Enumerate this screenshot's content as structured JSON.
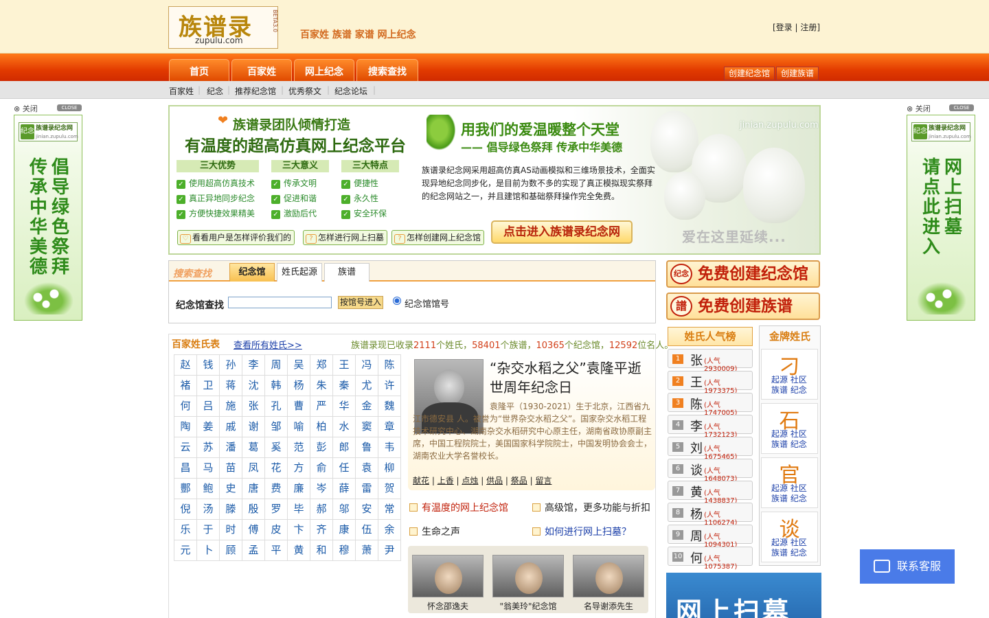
{
  "header": {
    "logo_cn": "族谱录",
    "logo_en": "zupulu.com",
    "logo_beta": "BETA3.0",
    "slogan": "百家姓 族谱 家谱 网上纪念",
    "login": "[登录",
    "auth_sep": "|",
    "register": "注册]"
  },
  "nav": {
    "items": [
      "首页",
      "百家姓",
      "网上纪念",
      "搜索查找"
    ],
    "create_memorial": "创建纪念馆",
    "create_genealogy": "创建族谱"
  },
  "subnav": {
    "items": [
      "百家姓",
      "纪念",
      "推荐纪念馆",
      "优秀祭文",
      "纪念论坛"
    ]
  },
  "side_left": {
    "close": "关闭",
    "badge": "CLOSE",
    "logo_line1": "族谱录纪念网",
    "logo_line2": "jinian.zupulu.com",
    "seal": "纪念",
    "col_right": "倡导绿色祭拜",
    "col_left": "传承中华美德"
  },
  "side_right": {
    "close": "关闭",
    "badge": "CLOSE",
    "logo_line1": "族谱录纪念网",
    "logo_line2": "jinian.zupulu.com",
    "seal": "纪念",
    "col_right": "网上扫墓",
    "col_left": "请点此进入"
  },
  "banner": {
    "heart": "❤",
    "title1": "族谱录团队倾情打造",
    "title2": "有温度的超高仿真网上纪念平台",
    "col1_head": "三大优势",
    "col1": [
      "使用超高仿真技术",
      "真正异地同步纪念",
      "方便快捷效果精美"
    ],
    "col2_head": "三大意义",
    "col2": [
      "传承文明",
      "促进和谐",
      "激励后代"
    ],
    "col3_head": "三大特点",
    "col3": [
      "便捷性",
      "永久性",
      "安全环保"
    ],
    "btn_reviews": "看看用户是怎样评价我们的",
    "btn_how_scan": "怎样进行网上扫墓",
    "btn_how_create": "怎样创建网上纪念馆",
    "enter": "点击进入族谱录纪念网",
    "right_title": "用我们的爱温暖整个天堂",
    "right_sub": "—— 倡导绿色祭拜 传承中华美德",
    "url": "jinian.zupulu.com",
    "desc": "族谱录纪念网采用超高仿真AS动画模拟和三维场景技术，全面实现异地纪念同步化，是目前为数不多的实现了真正模拟现实祭拜的纪念网站之一，并且建馆和基础祭拜操作完全免费。",
    "bottom": "爱在这里延续..."
  },
  "search": {
    "title": "搜索查找",
    "tabs": [
      "纪念馆",
      "姓氏起源",
      "族谱"
    ],
    "label": "纪念馆查找",
    "input_value": "",
    "button": "按馆号进入",
    "radio_label": "纪念馆馆号"
  },
  "create_buttons": {
    "memorial": "免费创建纪念馆",
    "memorial_seal": "纪念",
    "genealogy": "免费创建族谱",
    "genealogy_seal": "譜"
  },
  "surnames": {
    "title": "百家姓氏表",
    "view_all": "查看所有姓氏>>",
    "stat_pre": "族谱录现已收录",
    "surname_count": "2111",
    "stat_a": "个姓氏，",
    "genealogy_count": "58401",
    "stat_b": "个族谱，",
    "memorial_count": "10365",
    "stat_c": "个纪念馆，",
    "person_count": "12592",
    "stat_d": "位名人。",
    "list": [
      "赵",
      "钱",
      "孙",
      "李",
      "周",
      "吴",
      "郑",
      "王",
      "冯",
      "陈",
      "褚",
      "卫",
      "蒋",
      "沈",
      "韩",
      "杨",
      "朱",
      "秦",
      "尤",
      "许",
      "何",
      "吕",
      "施",
      "张",
      "孔",
      "曹",
      "严",
      "华",
      "金",
      "魏",
      "陶",
      "姜",
      "戚",
      "谢",
      "邹",
      "喻",
      "柏",
      "水",
      "窦",
      "章",
      "云",
      "苏",
      "潘",
      "葛",
      "奚",
      "范",
      "彭",
      "郎",
      "鲁",
      "韦",
      "昌",
      "马",
      "苗",
      "凤",
      "花",
      "方",
      "俞",
      "任",
      "袁",
      "柳",
      "酆",
      "鲍",
      "史",
      "唐",
      "费",
      "廉",
      "岑",
      "薛",
      "雷",
      "贺",
      "倪",
      "汤",
      "滕",
      "殷",
      "罗",
      "毕",
      "郝",
      "邬",
      "安",
      "常",
      "乐",
      "于",
      "时",
      "傅",
      "皮",
      "卞",
      "齐",
      "康",
      "伍",
      "余",
      "元",
      "卜",
      "顾",
      "孟",
      "平",
      "黄",
      "和",
      "穆",
      "萧",
      "尹"
    ]
  },
  "feature": {
    "title": "“杂交水稻之父”袁隆平逝世周年纪念日",
    "desc": "袁隆平（1930-2021）生于北京，江西省九江市德安县 人。被誉为“世界杂交水稻之父”。国家杂交水稻工程技术研究中心、湖南杂交水稻研究中心原主任，湖南省政协原副主席，中国工程院院士，美国国家科学院院士，中国发明协会会士，湖南农业大学名誉校长。",
    "actions": [
      "献花",
      "上香",
      "点烛",
      "供品",
      "祭品",
      "留言"
    ],
    "link1": "有温度的网上纪念馆",
    "link2": "高级馆，更多功能与折扣",
    "link3": "生命之声",
    "link4": "如何进行网上扫墓？"
  },
  "thumbs": [
    "怀念邵逸夫",
    "\"翁美玲\"纪念馆",
    "名导谢添先生"
  ],
  "rank": {
    "title": "姓氏人气榜",
    "items": [
      {
        "no": "1",
        "name": "张",
        "pop": "(人气2930009)"
      },
      {
        "no": "2",
        "name": "王",
        "pop": "(人气1973375)"
      },
      {
        "no": "3",
        "name": "陈",
        "pop": "(人气1747005)"
      },
      {
        "no": "4",
        "name": "李",
        "pop": "(人气1732123)"
      },
      {
        "no": "5",
        "name": "刘",
        "pop": "(人气1675465)"
      },
      {
        "no": "6",
        "name": "谈",
        "pop": "(人气1648073)"
      },
      {
        "no": "7",
        "name": "黄",
        "pop": "(人气1438837)"
      },
      {
        "no": "8",
        "name": "杨",
        "pop": "(人气1106274)"
      },
      {
        "no": "9",
        "name": "周",
        "pop": "(人气1094301)"
      },
      {
        "no": "10",
        "name": "何",
        "pop": "(人气1075387)"
      }
    ]
  },
  "gold": {
    "title": "金牌姓氏",
    "items": [
      {
        "name": "刁",
        "l1": "起源 社区",
        "l2": "族谱 纪念"
      },
      {
        "name": "石",
        "l1": "起源 社区",
        "l2": "族谱 纪念"
      },
      {
        "name": "官",
        "l1": "起源 社区",
        "l2": "族谱 纪念"
      },
      {
        "name": "谈",
        "l1": "起源 社区",
        "l2": "族谱 纪念"
      }
    ]
  },
  "scan_ad": "网上扫墓",
  "chat": "联系客服"
}
